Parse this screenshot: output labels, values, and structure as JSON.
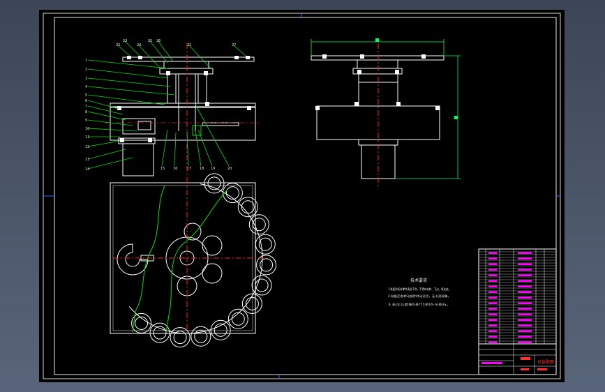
{
  "drawing": {
    "view_labels": {
      "front_section": "",
      "side_view": "",
      "top_view": ""
    },
    "leader_numbers": [
      "1",
      "2",
      "3",
      "4",
      "5",
      "6",
      "7",
      "8",
      "9",
      "10",
      "11",
      "12",
      "13",
      "14",
      "15",
      "16",
      "17",
      "18",
      "19",
      "20",
      "21",
      "22",
      "23",
      "24",
      "25",
      "26",
      "27"
    ],
    "notes": {
      "heading": "技术要求",
      "lines": [
        "1.装配前所有零件清洗干净，不得有毛刺、飞边、氧化皮。",
        "2.装配后各转动部件转动灵活，无卡滞现象。",
        "3.未注公差按GB/T1804-m执行。"
      ]
    },
    "title_block": {
      "drawing_title": "总装配图",
      "part_name": "",
      "scale": ""
    },
    "colors": {
      "sheet": "#000000",
      "frame": "#ffffff",
      "centerline": "#ff2020",
      "leader": "#00e000",
      "text_magenta": "#ff00ff",
      "text_red": "#ff3030",
      "dimension": "#00ff60"
    }
  }
}
